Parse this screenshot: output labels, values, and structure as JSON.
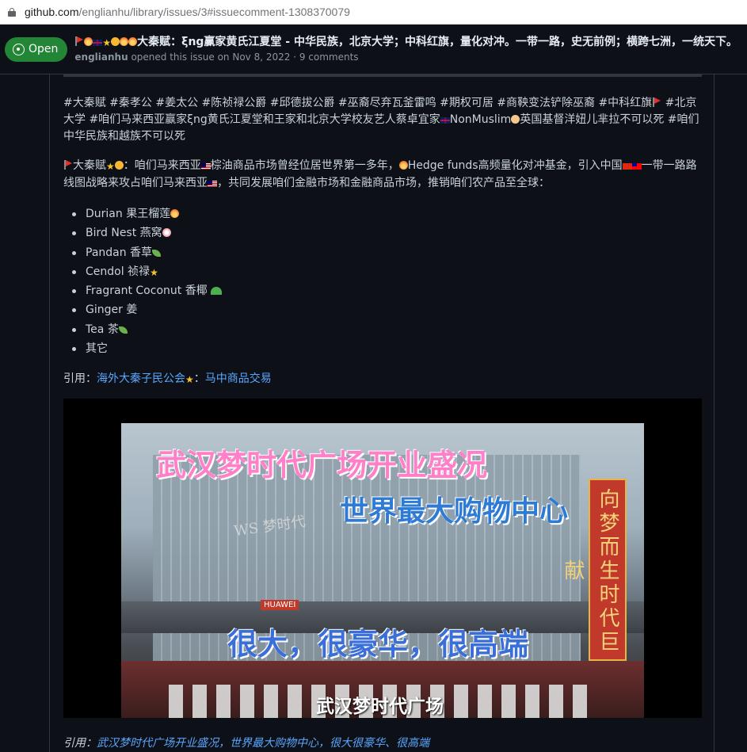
{
  "browser": {
    "url_host": "github.com",
    "url_path": "/englianhu/library/issues/3#issuecomment-1308370079"
  },
  "issue": {
    "state": "Open",
    "title": "大秦赋：ξng赢家黄氏江夏堂 - 中华民族，北京大学；中科红旗，量化对冲。一带一路，史无前例；横跨七洲，一统天下。",
    "author": "englianhu",
    "meta": "opened this issue on Nov 8, 2022 · 9 comments"
  },
  "comment": {
    "tags": "#大秦赋 #秦孝公 #姜太公 #陈祯禄公爵 #邱德拔公爵 #巫裔尽弃瓦釜雷鸣 #期权可居 #商鞅变法铲除巫裔 #中科红旗",
    "tags_2": " #北京大学 #咱们马来西亚赢家ξng黄氏江夏堂和王家和北京大学校友艺人蔡卓宜家",
    "tags_3": "NonMuslim",
    "tags_4": "英国基督洋妞儿芈拉不可以死 #咱们中华民族和越族不可以死",
    "intro_1": "大秦赋",
    "intro_2": "：咱们马来西亚",
    "intro_3": "棕油商品市场曾经位居世界第一多年，",
    "intro_4": "Hedge funds高频量化对冲基金，引入中国",
    "intro_5": "一带一路路线图战略来攻占咱们马来西亚",
    "intro_6": "，共同发展咱们金融市场和金融商品市场，推销咱们农产品至全球：",
    "products": [
      "Durian 果王榴莲",
      "Bird Nest 燕窝",
      "Pandan 香草",
      "Cendol 祯禄",
      "Fragrant Coconut 香椰",
      "Ginger 姜",
      "Tea 茶",
      "其它"
    ],
    "ref_label": "引用：",
    "ref_link_1": "海外大秦子民公会",
    "ref_sep": "：",
    "ref_link_2": "马中商品交易",
    "video_caption_1": "武汉梦时代广场开业盛况",
    "video_caption_2": "世界最大购物中心",
    "video_caption_3": "很大，很豪华，很高端",
    "video_caption_4": "武汉梦时代广场",
    "video_banner": "向梦而生时代巨献",
    "video_sign": "HUAWEI",
    "ref2_label": "引用：",
    "ref2_link": "武汉梦时代广场开业盛况，世界最大购物中心，很大很豪华、很高端"
  },
  "colors": {
    "open_badge": "#238636",
    "link": "#58a6ff",
    "background": "#0d1117"
  },
  "icons": [
    "lock-icon",
    "issue-opened-icon",
    "flag-emoji",
    "star-emoji",
    "sprout-emoji",
    "palm-emoji"
  ]
}
